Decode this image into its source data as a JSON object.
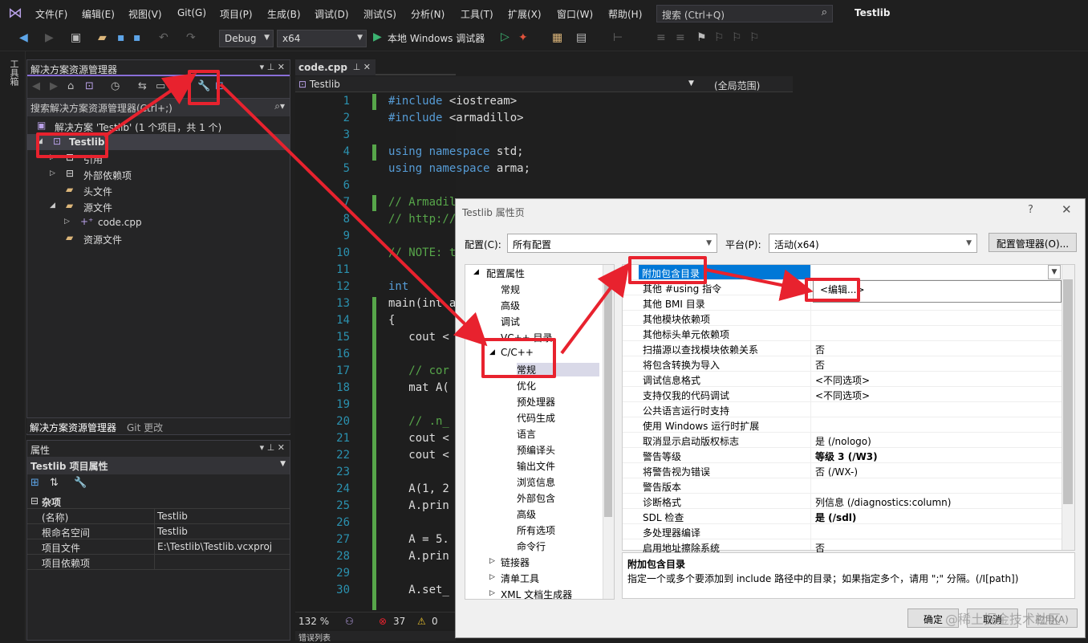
{
  "menu": {
    "items": [
      "文件(F)",
      "编辑(E)",
      "视图(V)",
      "Git(G)",
      "项目(P)",
      "生成(B)",
      "调试(D)",
      "测试(S)",
      "分析(N)",
      "工具(T)",
      "扩展(X)",
      "窗口(W)",
      "帮助(H)"
    ],
    "search_placeholder": "搜索 (Ctrl+Q)",
    "app_title": "Testlib"
  },
  "toolbar": {
    "config": "Debug",
    "platform": "x64",
    "run_label": "本地 Windows 调试器"
  },
  "left_strip": {
    "label": "工具箱"
  },
  "solution_explorer": {
    "title": "解决方案资源管理器",
    "search_placeholder": "搜索解决方案资源管理器(Ctrl+;)",
    "tree": [
      {
        "label": "解决方案 'Testlib' (1 个项目，共 1 个)"
      },
      {
        "label": "Testlib"
      },
      {
        "label": "引用"
      },
      {
        "label": "外部依赖项"
      },
      {
        "label": "头文件"
      },
      {
        "label": "源文件"
      },
      {
        "label": "code.cpp"
      },
      {
        "label": "资源文件"
      }
    ],
    "tabs": [
      "解决方案资源管理器",
      "Git 更改"
    ]
  },
  "properties": {
    "title": "属性",
    "selector": "Testlib 项目属性",
    "section": "杂项",
    "rows": [
      {
        "key": "(名称)",
        "value": "Testlib"
      },
      {
        "key": "根命名空间",
        "value": "Testlib"
      },
      {
        "key": "项目文件",
        "value": "E:\\Testlib\\Testlib.vcxproj"
      },
      {
        "key": "项目依赖项",
        "value": ""
      }
    ]
  },
  "editor": {
    "tab": "code.cpp",
    "project": "Testlib",
    "scope": "(全局范围)",
    "line_numbers": [
      "1",
      "2",
      "3",
      "4",
      "5",
      "6",
      "7",
      "8",
      "9",
      "10",
      "11",
      "12",
      "13",
      "14",
      "15",
      "16",
      "17",
      "18",
      "19",
      "20",
      "21",
      "22",
      "23",
      "24",
      "25",
      "26",
      "27",
      "28",
      "29",
      "30"
    ],
    "zoom": "132 %",
    "errors": "37",
    "warnings": "0",
    "output_label": "错误列表"
  },
  "dialog": {
    "title": "Testlib 属性页",
    "help": "?",
    "close": "✕",
    "config_label": "配置(C):",
    "config_value": "所有配置",
    "platform_label": "平台(P):",
    "platform_value": "活动(x64)",
    "config_manager": "配置管理器(O)...",
    "categories": [
      {
        "label": "配置属性"
      },
      {
        "label": "常规"
      },
      {
        "label": "高级"
      },
      {
        "label": "调试"
      },
      {
        "label": "VC++ 目录"
      },
      {
        "label": "C/C++"
      },
      {
        "label": "常规"
      },
      {
        "label": "优化"
      },
      {
        "label": "预处理器"
      },
      {
        "label": "代码生成"
      },
      {
        "label": "语言"
      },
      {
        "label": "预编译头"
      },
      {
        "label": "输出文件"
      },
      {
        "label": "浏览信息"
      },
      {
        "label": "外部包含"
      },
      {
        "label": "高级"
      },
      {
        "label": "所有选项"
      },
      {
        "label": "命令行"
      },
      {
        "label": "链接器"
      },
      {
        "label": "清单工具"
      },
      {
        "label": "XML 文档生成器"
      }
    ],
    "props": [
      {
        "key": "附加包含目录",
        "value": ""
      },
      {
        "key": "其他 #using 指令",
        "value": ""
      },
      {
        "key": "其他 BMI 目录",
        "value": ""
      },
      {
        "key": "其他模块依赖项",
        "value": ""
      },
      {
        "key": "其他标头单元依赖项",
        "value": ""
      },
      {
        "key": "扫描源以查找模块依赖关系",
        "value": "否"
      },
      {
        "key": "将包含转换为导入",
        "value": "否"
      },
      {
        "key": "调试信息格式",
        "value": "<不同选项>"
      },
      {
        "key": "支持仅我的代码调试",
        "value": "<不同选项>"
      },
      {
        "key": "公共语言运行时支持",
        "value": ""
      },
      {
        "key": "使用 Windows 运行时扩展",
        "value": ""
      },
      {
        "key": "取消显示启动版权标志",
        "value": "是 (/nologo)"
      },
      {
        "key": "警告等级",
        "value": "等级 3 (/W3)"
      },
      {
        "key": "将警告视为错误",
        "value": "否 (/WX-)"
      },
      {
        "key": "警告版本",
        "value": ""
      },
      {
        "key": "诊断格式",
        "value": "列信息 (/diagnostics:column)"
      },
      {
        "key": "SDL 检查",
        "value": "是 (/sdl)"
      },
      {
        "key": "多处理器编译",
        "value": ""
      },
      {
        "key": "启用地址擦除系统",
        "value": "否"
      }
    ],
    "edit_option": "<编辑...>",
    "desc_title": "附加包含目录",
    "desc_text": "指定一个或多个要添加到 include 路径中的目录；如果指定多个，请用 \";\" 分隔。(/I[path])",
    "ok": "确定",
    "cancel": "取消",
    "apply": "应用(A)",
    "watermark": "@稀土掘金技术社区"
  },
  "colors": {
    "highlight": "#e8222e",
    "selection": "#0078d7",
    "accent": "#8a6fd8"
  }
}
